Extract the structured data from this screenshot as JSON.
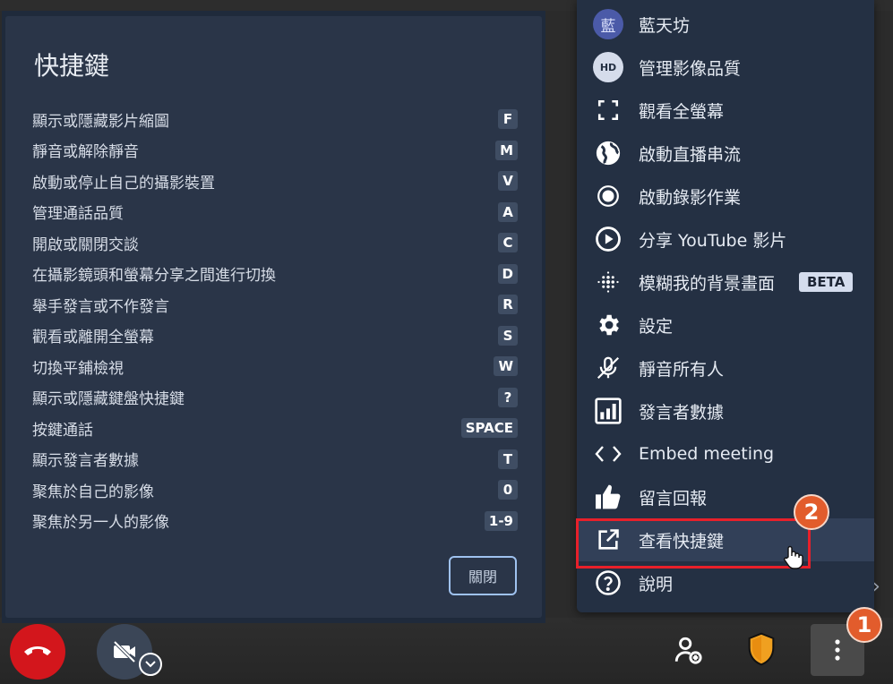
{
  "dialog": {
    "title": "快捷鍵",
    "shortcuts": [
      {
        "label": "顯示或隱藏影片縮圖",
        "key": "F"
      },
      {
        "label": "靜音或解除靜音",
        "key": "M"
      },
      {
        "label": "啟動或停止自己的攝影裝置",
        "key": "V"
      },
      {
        "label": "管理通話品質",
        "key": "A"
      },
      {
        "label": "開啟或關閉交談",
        "key": "C"
      },
      {
        "label": "在攝影鏡頭和螢幕分享之間進行切換",
        "key": "D"
      },
      {
        "label": "舉手發言或不作發言",
        "key": "R"
      },
      {
        "label": "觀看或離開全螢幕",
        "key": "S"
      },
      {
        "label": "切換平鋪檢視",
        "key": "W"
      },
      {
        "label": "顯示或隱藏鍵盤快捷鍵",
        "key": "?"
      },
      {
        "label": "按鍵通話",
        "key": "SPACE"
      },
      {
        "label": "顯示發言者數據",
        "key": "T"
      },
      {
        "label": "聚焦於自己的影像",
        "key": "0"
      },
      {
        "label": "聚焦於另一人的影像",
        "key": "1-9"
      }
    ],
    "close_label": "關閉"
  },
  "menu": {
    "items": [
      {
        "label": "藍天坊",
        "icon": "user-avatar-icon",
        "avatar_text": "藍"
      },
      {
        "label": "管理影像品質",
        "icon": "hd-icon",
        "avatar_text": "HD"
      },
      {
        "label": "觀看全螢幕",
        "icon": "fullscreen-icon"
      },
      {
        "label": "啟動直播串流",
        "icon": "globe-icon"
      },
      {
        "label": "啟動錄影作業",
        "icon": "record-icon"
      },
      {
        "label": "分享 YouTube 影片",
        "icon": "play-circle-icon"
      },
      {
        "label": "模糊我的背景畫面",
        "icon": "blur-icon",
        "badge": "BETA"
      },
      {
        "label": "設定",
        "icon": "gear-icon"
      },
      {
        "label": "靜音所有人",
        "icon": "mic-off-icon"
      },
      {
        "label": "發言者數據",
        "icon": "bar-chart-icon"
      },
      {
        "label": "Embed meeting",
        "icon": "code-icon"
      },
      {
        "label": "留言回報",
        "icon": "thumbs-up-icon"
      },
      {
        "label": "查看快捷鍵",
        "icon": "open-external-icon"
      },
      {
        "label": "說明",
        "icon": "help-icon"
      }
    ]
  },
  "annotations": {
    "step1": "1",
    "step2": "2"
  },
  "colors": {
    "hangup": "#d3161c",
    "accent_badge": "#e25c2c",
    "highlight": "#e8202a",
    "menu_bg": "#243043"
  }
}
